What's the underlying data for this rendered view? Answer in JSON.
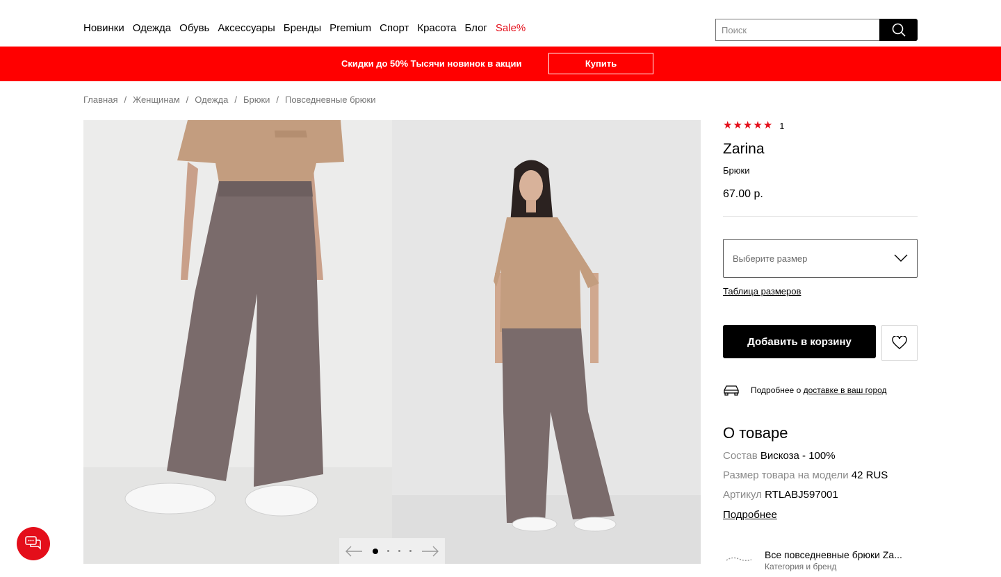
{
  "nav": {
    "items": [
      "Новинки",
      "Одежда",
      "Обувь",
      "Аксессуары",
      "Бренды",
      "Premium",
      "Спорт",
      "Красота",
      "Блог",
      "Sale%"
    ]
  },
  "search": {
    "placeholder": "Поиск",
    "icon": "search-icon"
  },
  "promo": {
    "text": "Скидки до 50% Тысячи новинок в акции",
    "button": "Купить"
  },
  "breadcrumbs": [
    "Главная",
    "Женщинам",
    "Одежда",
    "Брюки",
    "Повседневные брюки"
  ],
  "gallery": {
    "dots_total": 4,
    "active_dot": 1,
    "prev_icon": "arrow-left-icon",
    "next_icon": "arrow-right-icon"
  },
  "product": {
    "rating": 5,
    "rating_count": "1",
    "brand": "Zarina",
    "type": "Брюки",
    "price": "67.00 р.",
    "size_placeholder": "Выберите размер",
    "size_table": "Таблица размеров",
    "add_to_cart": "Добавить в корзину",
    "delivery_prefix": "Подробнее о",
    "delivery_link": "доставке в ваш город"
  },
  "about": {
    "title": "О товаре",
    "attributes": [
      {
        "key": "Состав",
        "value": "Вискоза - 100%"
      },
      {
        "key": "Размер товара на модели",
        "value": "42 RUS"
      },
      {
        "key": "Артикул",
        "value": "RTLABJ597001"
      }
    ],
    "more": "Подробнее"
  },
  "related": {
    "title": "Все повседневные брюки Za...",
    "subtitle": "Категория и бренд"
  },
  "colors": {
    "accent_red": "#ff0000",
    "sale_red": "#e40e1a",
    "pants": "#7a6b6b",
    "tshirt": "#c39d7f"
  }
}
